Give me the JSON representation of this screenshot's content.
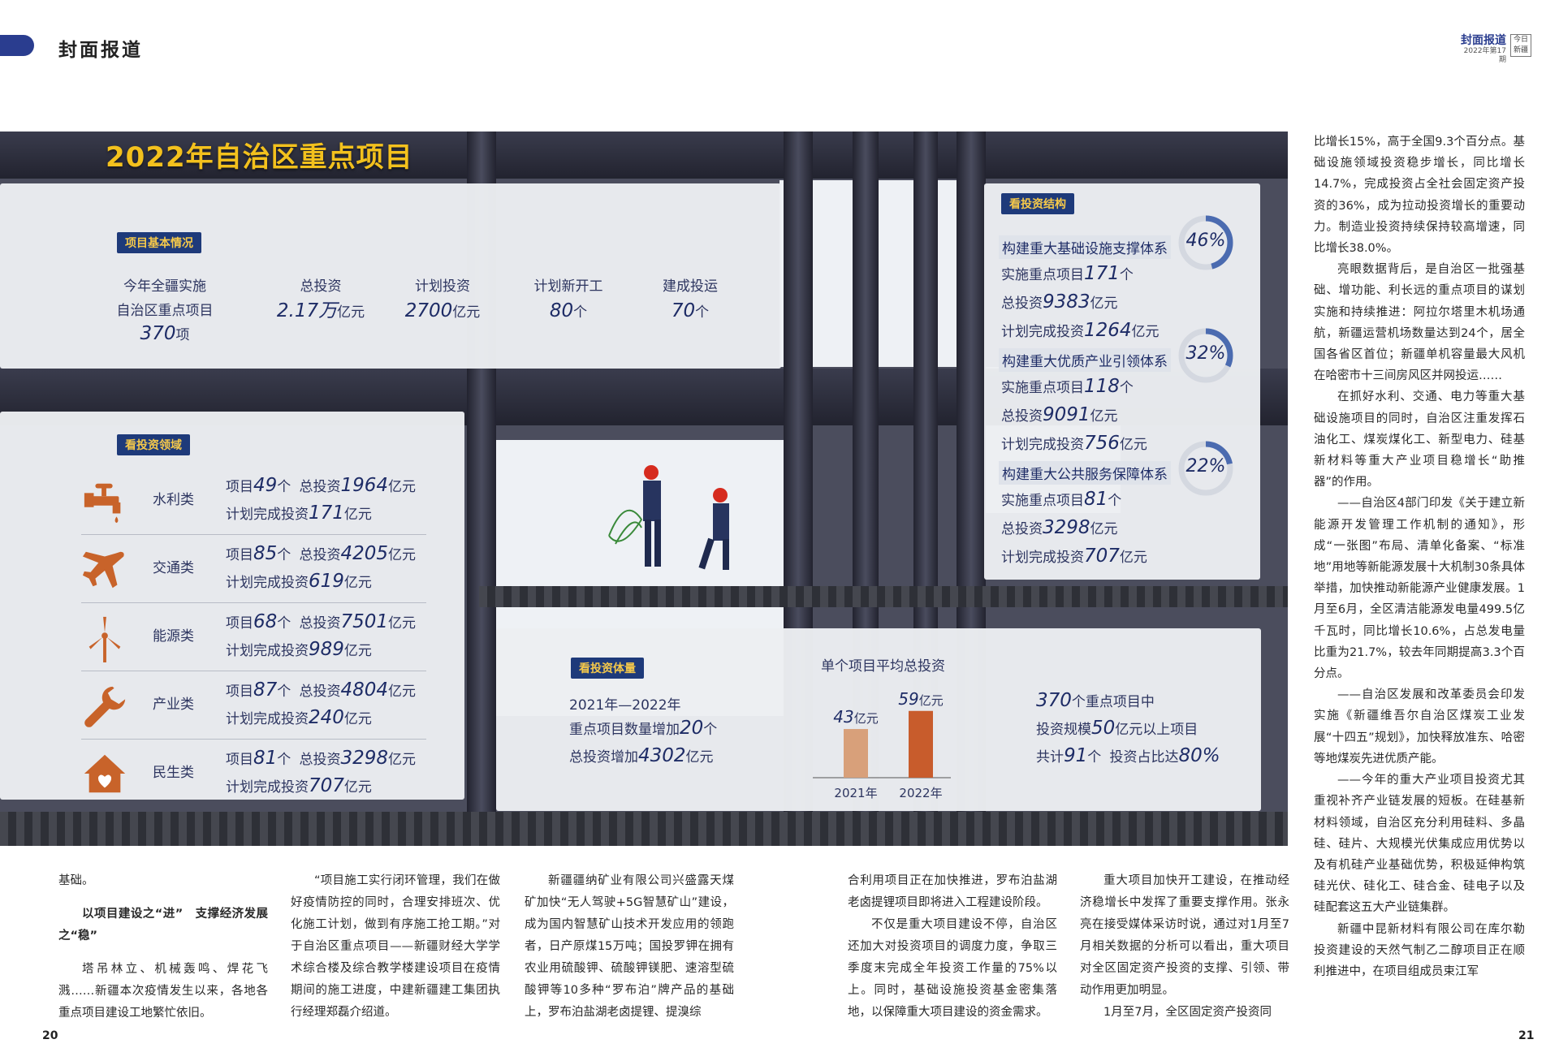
{
  "header": {
    "section": "封面报道",
    "brand": "封面报道",
    "issue": "2022年第17期",
    "logo_text": "今日新疆"
  },
  "infographic": {
    "title": "2022年自治区重点项目",
    "basic": {
      "tag": "项目基本情况",
      "intro_1": "今年全疆实施",
      "intro_2": "自治区重点项目",
      "count": "370",
      "count_unit": "项",
      "stats": [
        {
          "label": "总投资",
          "value": "2.17万",
          "unit": "亿元"
        },
        {
          "label": "计划投资",
          "value": "2700",
          "unit": "亿元"
        },
        {
          "label": "计划新开工",
          "value": "80",
          "unit": "个"
        },
        {
          "label": "建成投运",
          "value": "70",
          "unit": "个"
        }
      ]
    },
    "fields": {
      "tag": "看投资领域",
      "items": [
        {
          "name": "水利类",
          "icon": "faucet-icon",
          "projects": "49",
          "invest": "1964",
          "planned": "171"
        },
        {
          "name": "交通类",
          "icon": "airplane-icon",
          "projects": "85",
          "invest": "4205",
          "planned": "619"
        },
        {
          "name": "能源类",
          "icon": "wind-turbine-icon",
          "projects": "68",
          "invest": "7501",
          "planned": "989"
        },
        {
          "name": "产业类",
          "icon": "wrench-icon",
          "projects": "87",
          "invest": "4804",
          "planned": "240"
        },
        {
          "name": "民生类",
          "icon": "house-icon",
          "projects": "81",
          "invest": "3298",
          "planned": "707"
        }
      ],
      "lbl_project": "项目",
      "unit_ge": "个",
      "lbl_invest": "总投资",
      "unit_yi": "亿元",
      "lbl_planned": "计划完成投资"
    },
    "structure": {
      "tag": "看投资结构",
      "lbl_projects": "实施重点项目",
      "lbl_invest": "总投资",
      "lbl_planned": "计划完成投资",
      "unit_ge": "个",
      "unit_yi": "亿元",
      "systems": [
        {
          "title": "构建重大基础设施支撑体系",
          "pct": "46%",
          "fraction": 0.46,
          "projects": "171",
          "invest": "9383",
          "planned": "1264"
        },
        {
          "title": "构建重大优质产业引领体系",
          "pct": "32%",
          "fraction": 0.32,
          "projects": "118",
          "invest": "9091",
          "planned": "756"
        },
        {
          "title": "构建重大公共服务保障体系",
          "pct": "22%",
          "fraction": 0.22,
          "projects": "81",
          "invest": "3298",
          "planned": "707"
        }
      ]
    },
    "volume": {
      "tag": "看投资体量",
      "line1": "2021年—2022年",
      "line2_pre": "重点项目数量增加",
      "line2_val": "20",
      "line2_unit": "个",
      "line3_pre": "总投资增加",
      "line3_val": "4302",
      "line3_unit": "亿元",
      "right1_val": "370",
      "right1_post": "个重点项目中",
      "right2_pre": "投资规模",
      "right2_val": "50",
      "right2_post": "亿元以上项目",
      "right3_pre": "共计",
      "right3_val": "91",
      "right3_unit": "个",
      "right3_pre2": "投资占比达",
      "right3_val2": "80%"
    }
  },
  "chart_data": {
    "type": "bar",
    "title": "单个项目平均总投资",
    "categories": [
      "2021年",
      "2022年"
    ],
    "values": [
      43,
      59
    ],
    "unit": "亿元",
    "colors": [
      "#d8a07a",
      "#c85c2c"
    ],
    "ylim": [
      0,
      70
    ]
  },
  "article": {
    "col1": [
      "基础。",
      "以项目建设之“进”　支撑经济发展之“稳”",
      "塔吊林立、机械轰鸣、焊花飞溅……新疆本次疫情发生以来，各地各重点项目建设工地繁忙依旧。"
    ],
    "col2": [
      "“项目施工实行闭环管理，我们在做好疫情防控的同时，合理安排班次、优化施工计划，做到有序施工抢工期。”对于自治区重点项目——新疆财经大学学术综合楼及综合教学楼建设项目在疫情期间的施工进度，中建新疆建工集团执行经理郑磊介绍道。"
    ],
    "col3": [
      "新疆疆纳矿业有限公司兴盛露天煤矿加快“无人驾驶+5G智慧矿山”建设，成为国内智慧矿山技术开发应用的领跑者，日产原煤15万吨；国投罗钾在拥有农业用硫酸钾、硫酸钾镁肥、速溶型硫酸钾等10多种“罗布泊”牌产品的基础上，罗布泊盐湖老卤提锂、提溴综"
    ],
    "col4": [
      "合利用项目正在加快推进，罗布泊盐湖老卤提锂项目即将进入工程建设阶段。",
      "不仅是重大项目建设不停，自治区还加大对投资项目的调度力度，争取三季度末完成全年投资工作量的75%以上。同时，基础设施投资基金密集落地，以保障重大项目建设的资金需求。"
    ],
    "col5": [
      "重大项目加快开工建设，在推动经济稳增长中发挥了重要支撑作用。张永亮在接受媒体采访时说，通过对1月至7月相关数据的分析可以看出，重大项目对全区固定资产投资的支撑、引领、带动作用更加明显。",
      "1月至7月，全区固定资产投资同"
    ],
    "col6": [
      "比增长15%，高于全国9.3个百分点。基础设施领域投资稳步增长，同比增长14.7%，完成投资占全社会固定资产投资的36%，成为拉动投资增长的重要动力。制造业投资持续保持较高增速，同比增长38.0%。",
      "亮眼数据背后，是自治区一批强基础、增功能、利长远的重点项目的谋划实施和持续推进：阿拉尔塔里木机场通航，新疆运营机场数量达到24个，居全国各省区首位；新疆单机容量最大风机在哈密市十三间房风区并网投运……",
      "在抓好水利、交通、电力等重大基础设施项目的同时，自治区注重发挥石油化工、煤炭煤化工、新型电力、硅基新材料等重大产业项目稳增长“助推器”的作用。",
      "——自治区4部门印发《关于建立新能源开发管理工作机制的通知》，形成“一张图”布局、清单化备案、“标准地”用地等新能源发展十大机制30条具体举措，加快推动新能源产业健康发展。1月至6月，全区清洁能源发电量499.5亿千瓦时，同比增长10.6%，占总发电量比重为21.7%，较去年同期提高3.3个百分点。",
      "——自治区发展和改革委员会印发实施《新疆维吾尔自治区煤炭工业发展“十四五”规划》，加快释放准东、哈密等地煤炭先进优质产能。",
      "——今年的重大产业项目投资尤其重视补齐产业链发展的短板。在硅基新材料领域，自治区充分利用硅料、多晶硅、硅片、大规模光伏集成应用优势以及有机硅产业基础优势，积极延伸构筑硅光伏、硅化工、硅合金、硅电子以及硅配套这五大产业链集群。",
      "新疆中昆新材料有限公司在库尔勒投资建设的天然气制乙二醇项目正在顺利推进中，在项目组成员束江军"
    ]
  },
  "pages": {
    "left": "20",
    "right": "21"
  }
}
